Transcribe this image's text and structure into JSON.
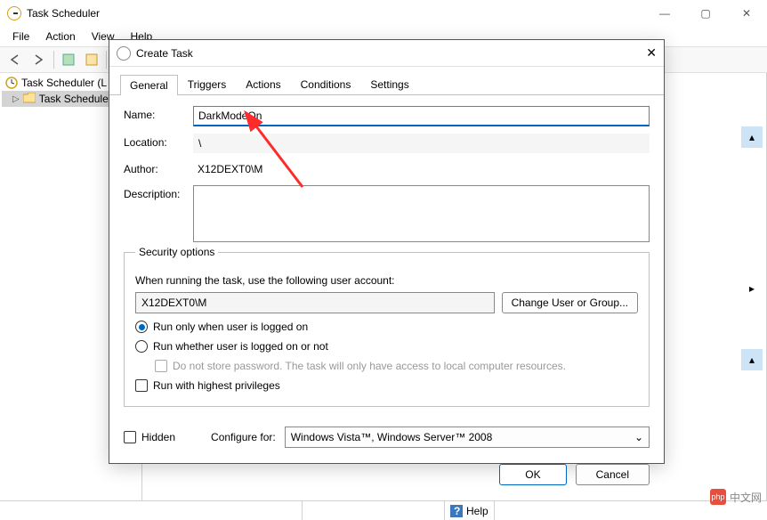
{
  "window": {
    "title": "Task Scheduler",
    "menu": [
      "File",
      "Action",
      "View",
      "Help"
    ],
    "tree": {
      "root": "Task Scheduler (L",
      "child": "Task Schedule"
    },
    "statusbar_help": "Help"
  },
  "dialog": {
    "title": "Create Task",
    "tabs": [
      "General",
      "Triggers",
      "Actions",
      "Conditions",
      "Settings"
    ],
    "active_tab": "General",
    "name_label": "Name:",
    "name_value": "DarkModeOn",
    "location_label": "Location:",
    "location_value": "\\",
    "author_label": "Author:",
    "author_value": "X12DEXT0\\M",
    "description_label": "Description:",
    "description_value": "",
    "security": {
      "legend": "Security options",
      "prompt": "When running the task, use the following user account:",
      "account": "X12DEXT0\\M",
      "change_btn": "Change User or Group...",
      "run_logged_on": "Run only when user is logged on",
      "run_whether": "Run whether user is logged on or not",
      "no_store": "Do not store password.  The task will only have access to local computer resources.",
      "highest": "Run with highest privileges"
    },
    "hidden_label": "Hidden",
    "configure_label": "Configure for:",
    "configure_value": "Windows Vista™, Windows Server™ 2008",
    "ok": "OK",
    "cancel": "Cancel"
  },
  "watermark": "中文网"
}
